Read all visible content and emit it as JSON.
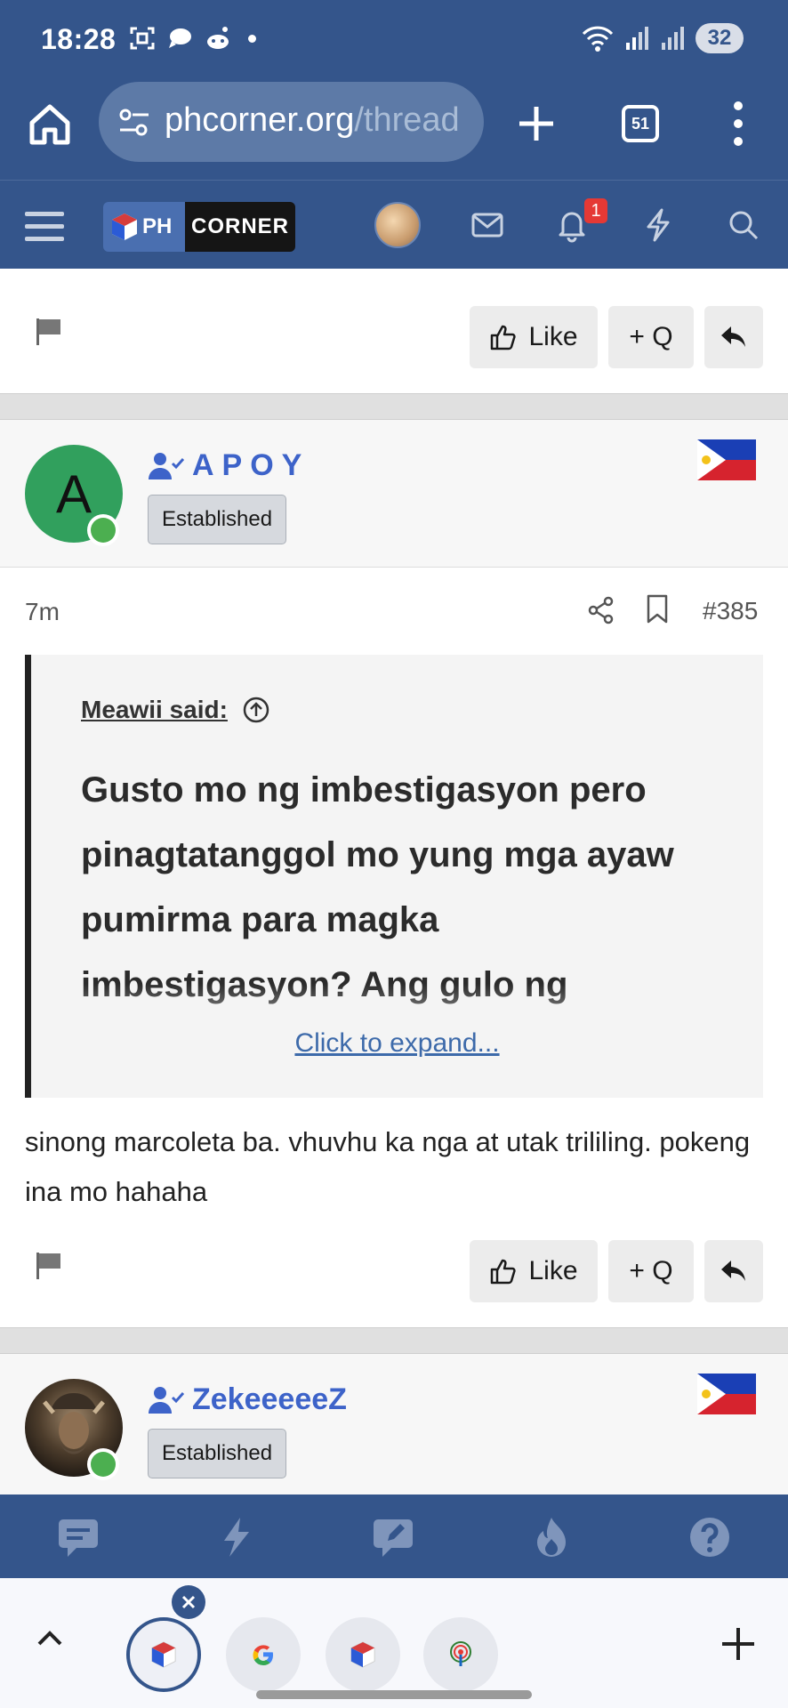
{
  "status": {
    "time": "18:28",
    "battery": "32"
  },
  "browser": {
    "url_main": "phcorner.org",
    "url_rest": "/thread",
    "tab_count": "51"
  },
  "site": {
    "logo_ph": "PH",
    "logo_corner": "CORNER",
    "notification_count": "1"
  },
  "post_top": {
    "like_label": "Like",
    "quote_label": "+ Q"
  },
  "post_385": {
    "username": "APOY",
    "avatar_letter": "A",
    "rank": "Established",
    "time": "7m",
    "number": "#385",
    "quote_author": "Meawii said:",
    "quote_lines": [
      "Gusto mo ng imbestigasyon pero",
      "pinagtatanggol mo yung mga ayaw",
      "pumirma para magka",
      "imbestigasyon? Ang gulo ng"
    ],
    "expand_label": "Click to expand...",
    "body": "sinong marcoleta ba. vhuvhu ka nga at utak trililing. pokeng ina mo hahaha",
    "like_label": "Like",
    "quote_label": "+ Q"
  },
  "post_next": {
    "username": "ZekeeeeeZ",
    "rank": "Established"
  },
  "colors": {
    "brand": "#34558b",
    "username": "#3d63c9",
    "online": "#4caf50",
    "badge": "#e53935"
  },
  "icons": {
    "forum_nav": [
      "chat-icon",
      "lightning-icon",
      "edit-icon",
      "fire-icon",
      "help-icon"
    ],
    "tabs": [
      "phcorner-tab-icon",
      "google-tab-icon",
      "phcorner-tab-icon",
      "broadcast-tab-icon"
    ]
  }
}
